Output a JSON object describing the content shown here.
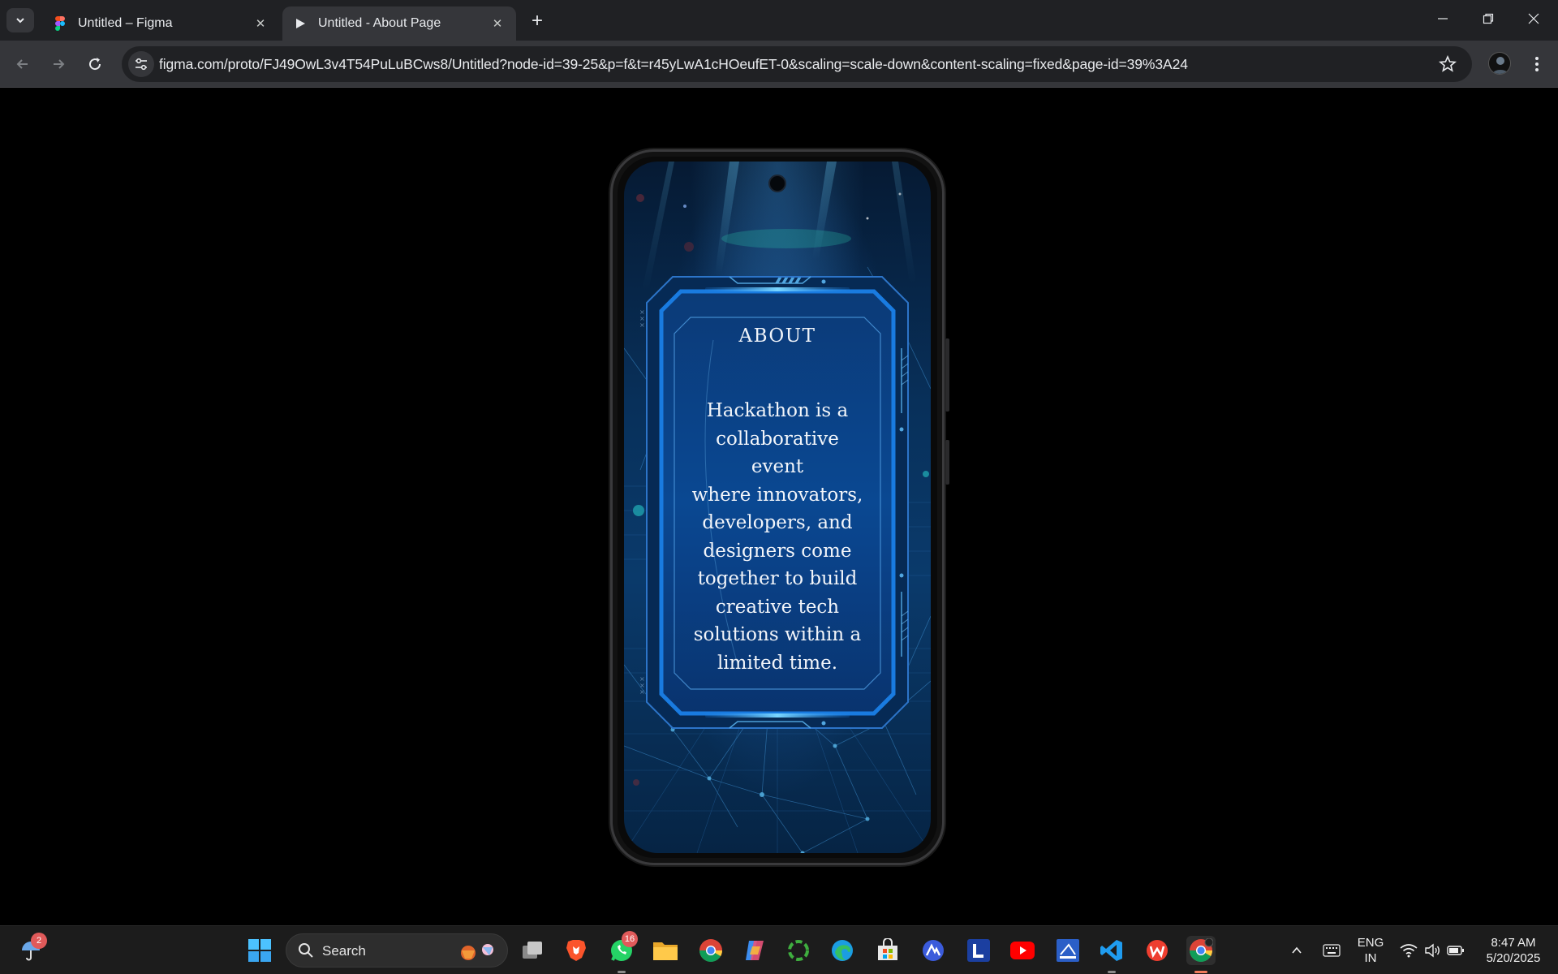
{
  "browser": {
    "tabs": [
      {
        "title": "Untitled – Figma",
        "favicon": "figma-icon",
        "active": false
      },
      {
        "title": "Untitled - About Page",
        "favicon": "play-icon",
        "active": true
      }
    ],
    "new_tab_label": "+",
    "url": "figma.com/proto/FJ49OwL3v4T54PuLuBCws8/Untitled?node-id=39-25&p=f&t=r45yLwA1cHOeufET-0&scaling=scale-down&content-scaling=fixed&page-id=39%3A24"
  },
  "prototype": {
    "heading": "ABOUT",
    "body": "Hackathon is a collaborative event where innovators, developers, and designers come together to build creative tech solutions within a limited time.",
    "body_lines": [
      "Hackathon is a",
      "collaborative event",
      "where innovators,",
      "developers, and",
      "designers come",
      "together to build",
      "creative tech",
      "solutions within a",
      "limited time."
    ]
  },
  "taskbar": {
    "weather_badge": "2",
    "search_label": "Search",
    "whatsapp_badge": "16",
    "lang_top": "ENG",
    "lang_bottom": "IN",
    "time": "8:47 AM",
    "date": "5/20/2025"
  },
  "colors": {
    "accent_blue": "#1e90ff",
    "screen_dark": "#061a33",
    "chrome_bg": "#202124",
    "toolbar_bg": "#35363a"
  }
}
